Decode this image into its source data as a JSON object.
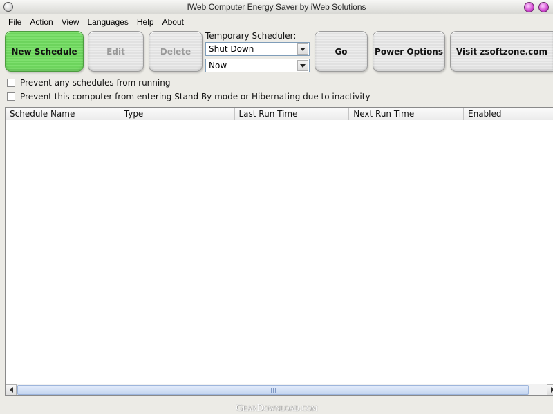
{
  "window": {
    "title": "IWeb Computer Energy Saver by iWeb Solutions"
  },
  "menu": {
    "items": [
      "File",
      "Action",
      "View",
      "Languages",
      "Help",
      "About"
    ]
  },
  "toolbar": {
    "new_schedule": "New Schedule",
    "edit": "Edit",
    "delete": "Delete",
    "scheduler_label": "Temporary Scheduler:",
    "action_value": "Shut Down",
    "when_value": "Now",
    "go": "Go",
    "power_options": "Power Options",
    "visit": "Visit zsoftzone.com"
  },
  "options": {
    "prevent_schedules": "Prevent any schedules from running",
    "prevent_standby": "Prevent this computer from entering Stand By mode or Hibernating due to inactivity"
  },
  "list": {
    "columns": [
      "Schedule Name",
      "Type",
      "Last Run Time",
      "Next Run Time",
      "Enabled"
    ],
    "rows": []
  },
  "watermark": "GearDownload.com",
  "colors": {
    "new_schedule_green": "#7ee06e",
    "window_bg": "#ecebe6",
    "title_orb": "#d24ad2",
    "scroll_thumb": "#c4d5f0"
  },
  "icons": {
    "system_menu": "circle-icon",
    "minimize": "purple-orb-icon",
    "maximize": "purple-orb-icon",
    "dropdown": "chevron-down-icon"
  }
}
